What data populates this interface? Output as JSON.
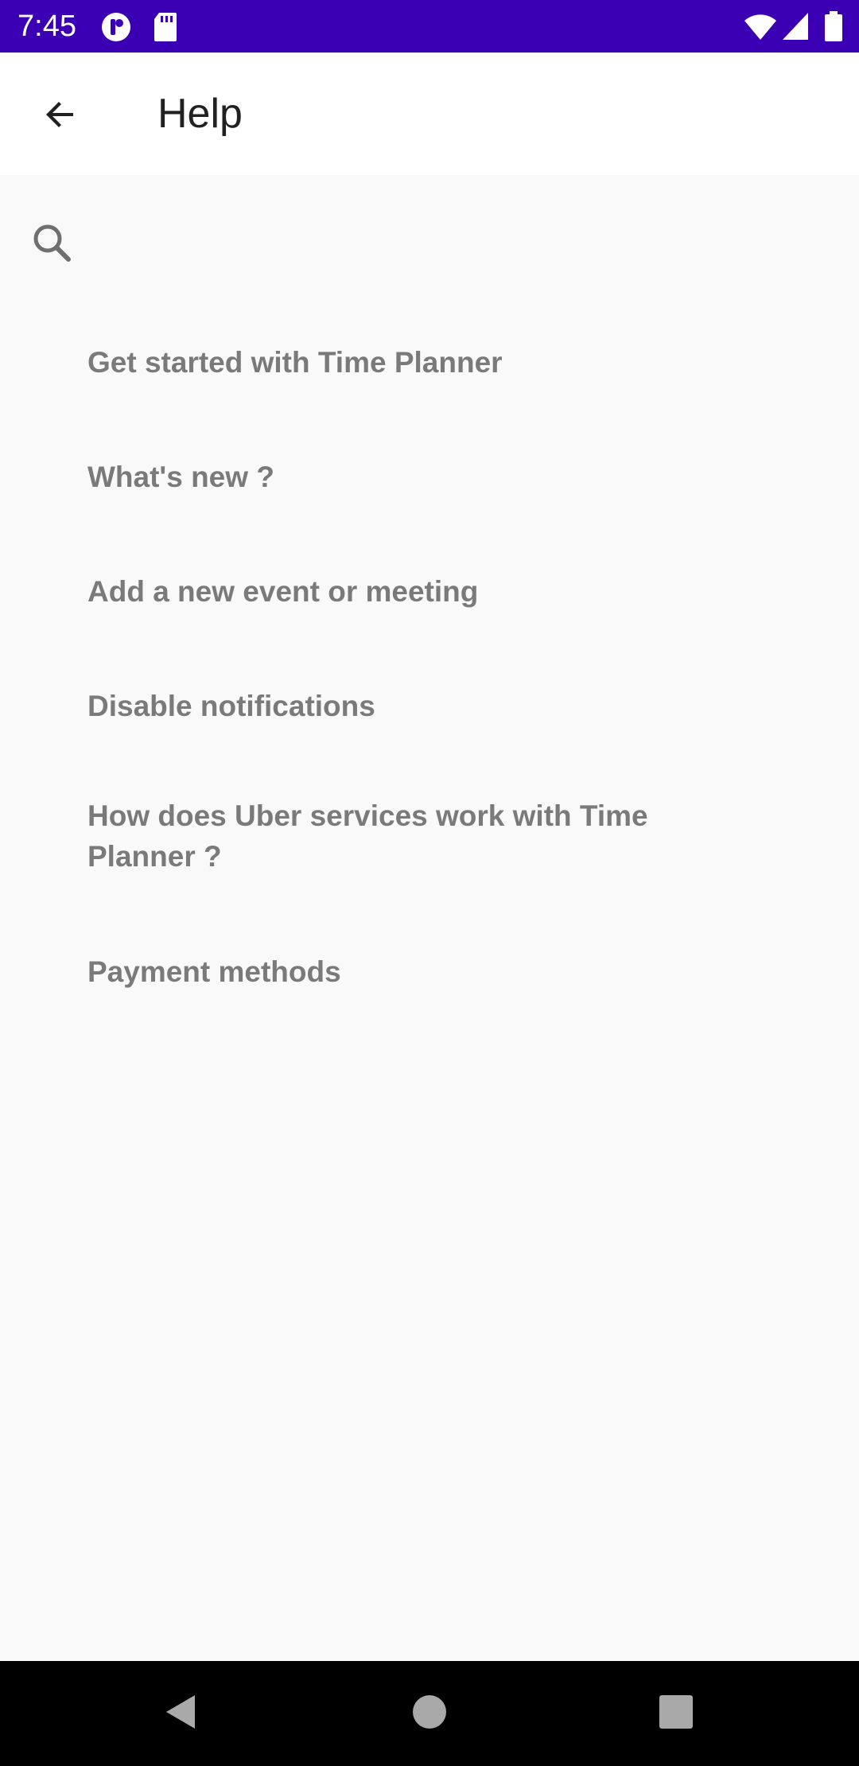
{
  "status_bar": {
    "time": "7:45",
    "icons": [
      "notification-app-icon",
      "sd-card-icon",
      "wifi-icon",
      "cell-signal-icon",
      "battery-icon"
    ],
    "background_color": "#3b00b3"
  },
  "app_bar": {
    "title": "Help",
    "back_icon": "arrow-back-icon"
  },
  "search": {
    "icon": "search-icon",
    "value": "",
    "placeholder": ""
  },
  "help_topics": [
    {
      "label": "Get started with Time Planner"
    },
    {
      "label": "What's new ?"
    },
    {
      "label": "Add a new event or meeting"
    },
    {
      "label": "Disable notifications"
    },
    {
      "label": "How does Uber services work with Time Planner ?"
    },
    {
      "label": "Payment methods"
    }
  ],
  "nav_bar": {
    "buttons": [
      "back-triangle-icon",
      "home-circle-icon",
      "recents-square-icon"
    ]
  }
}
